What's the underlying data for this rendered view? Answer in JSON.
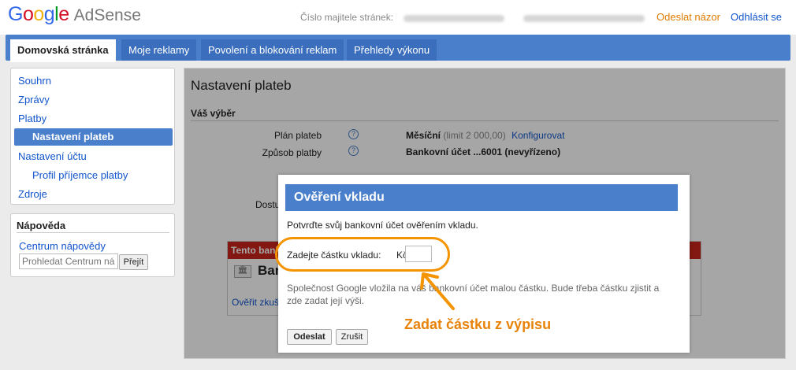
{
  "header": {
    "logo_google": "Google",
    "logo_product": "AdSense",
    "publisher_label": "Číslo majitele stránek:",
    "feedback": "Odeslat názor",
    "logout": "Odhlásit se",
    "brand_colors": [
      "#3369e8",
      "#d50f25",
      "#eeb211",
      "#3369e8",
      "#009925",
      "#d50f25"
    ]
  },
  "nav": {
    "tabs": [
      {
        "label": "Domovská stránka",
        "active": true
      },
      {
        "label": "Moje reklamy",
        "active": false
      },
      {
        "label": "Povolení a blokování reklam",
        "active": false
      },
      {
        "label": "Přehledy výkonu",
        "active": false
      }
    ]
  },
  "sidebar": {
    "items": [
      {
        "label": "Souhrn"
      },
      {
        "label": "Zprávy"
      },
      {
        "label": "Platby"
      },
      {
        "label": "Nastavení plateb",
        "active": true
      },
      {
        "label": "Nastavení účtu"
      },
      {
        "label": "Profil příjemce platby"
      },
      {
        "label": "Zdroje"
      }
    ]
  },
  "help": {
    "title": "Nápověda",
    "link": "Centrum nápovědy",
    "search_placeholder": "Prohledat Centrum nápovědy",
    "search_button": "Přejít"
  },
  "main": {
    "title": "Nastavení plateb",
    "section": "Váš výběr",
    "plan_label": "Plán plateb",
    "plan_value": "Měsíční",
    "plan_limit": "(limit 2 000,00)",
    "plan_configure": "Konfigurovat",
    "method_label": "Způsob platby",
    "method_value": "Bankovní účet ...6001 (nevyřízeno)",
    "partial_label": "Dostu",
    "bank_card_header": "Tento bank",
    "bank_name": "Ban",
    "bank_verify": "Ověřit zkuš"
  },
  "dialog": {
    "title": "Ověření vkladu",
    "text": "Potvrďte svůj bankovní účet ověřením vkladu.",
    "amount_label": "Zadejte částku vkladu:",
    "currency": "Kč",
    "amount_value": "",
    "note": "Společnost Google vložila na váš bankovní účet malou částku. Bude třeba částku zjistit a zde zadat její výši.",
    "submit": "Odeslat",
    "cancel": "Zrušit"
  },
  "annotation": {
    "text": "Zadat částku z výpisu",
    "color": "#f39400"
  }
}
